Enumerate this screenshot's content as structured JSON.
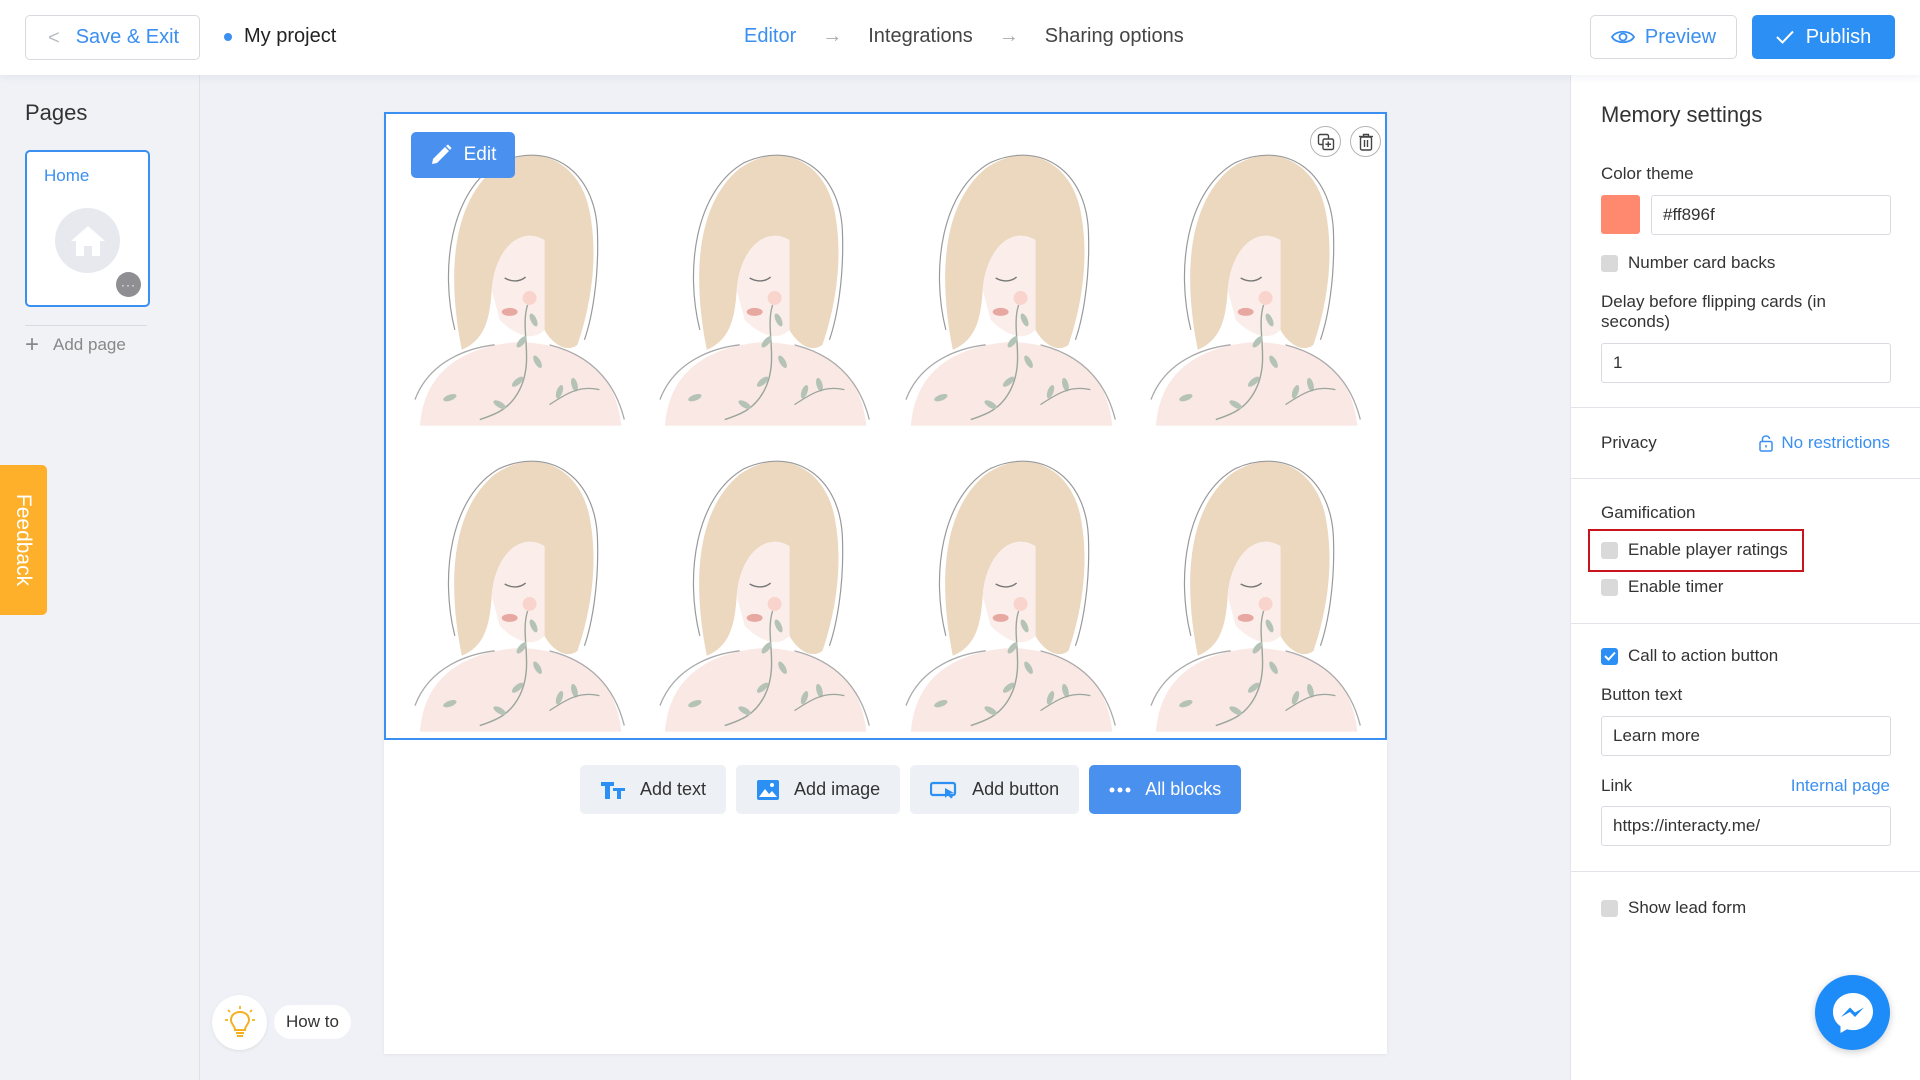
{
  "topbar": {
    "save_exit_label": "Save & Exit",
    "project_name": "My project",
    "steps": [
      {
        "label": "Editor",
        "active": true
      },
      {
        "label": "Integrations",
        "active": false
      },
      {
        "label": "Sharing options",
        "active": false
      }
    ],
    "step_arrow": "→",
    "preview_label": "Preview",
    "publish_label": "Publish"
  },
  "sidebar": {
    "title": "Pages",
    "pages": [
      {
        "name": "Home",
        "icon": "home-icon"
      }
    ],
    "add_page_label": "Add page",
    "more_glyph": "···"
  },
  "feedback_label": "Feedback",
  "canvas": {
    "edit_label": "Edit",
    "card_count": 8,
    "card_image": "girl-with-leaves-illustration",
    "add_buttons": [
      {
        "label": "Add text",
        "icon": "text-icon"
      },
      {
        "label": "Add image",
        "icon": "image-icon"
      },
      {
        "label": "Add button",
        "icon": "button-icon"
      },
      {
        "label": "All blocks",
        "icon": "dots-icon",
        "primary": true
      }
    ]
  },
  "howto_label": "How to",
  "settings": {
    "title": "Memory settings",
    "color_theme_label": "Color theme",
    "color_theme_value": "#ff896f",
    "number_card_backs_label": "Number card backs",
    "number_card_backs_checked": false,
    "delay_label": "Delay before flipping cards (in seconds)",
    "delay_value": "1",
    "privacy_label": "Privacy",
    "privacy_value": "No restrictions",
    "gamification_label": "Gamification",
    "enable_player_ratings_label": "Enable player ratings",
    "enable_player_ratings_checked": false,
    "enable_timer_label": "Enable timer",
    "enable_timer_checked": false,
    "cta_label": "Call to action button",
    "cta_checked": true,
    "button_text_label": "Button text",
    "button_text_value": "Learn more",
    "link_label": "Link",
    "link_type": "Internal page",
    "link_value": "https://interacty.me/",
    "show_lead_form_label": "Show lead form",
    "show_lead_form_checked": false
  },
  "colors": {
    "accent": "#3a8ff0",
    "publish": "#2b8ff3",
    "feedback": "#ffb02a",
    "highlight": "#c8141e",
    "messenger": "#1d8cf8"
  }
}
